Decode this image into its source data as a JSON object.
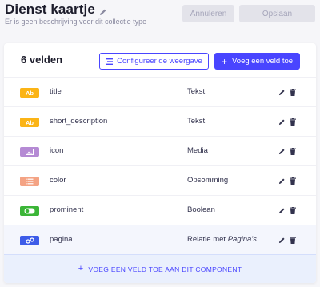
{
  "header": {
    "title": "Dienst kaartje",
    "subtitle": "Er is geen beschrijving voor dit collectie type",
    "cancel_label": "Annuleren",
    "save_label": "Opslaan"
  },
  "card": {
    "count_label": "6 velden",
    "configure_label": "Configureer de weergave",
    "add_field_label": "Voeg een veld toe",
    "add_component_label": "VOEG EEN VELD TOE AAN DIT COMPONENT"
  },
  "fields": [
    {
      "name": "title",
      "type": "Tekst",
      "badge": "Ab",
      "icon": "text-icon",
      "color": "#fbb416"
    },
    {
      "name": "short_description",
      "type": "Tekst",
      "badge": "Ab",
      "icon": "text-icon",
      "color": "#fbb416"
    },
    {
      "name": "icon",
      "type": "Media",
      "badge": "",
      "icon": "media-icon",
      "color": "#b58ad4"
    },
    {
      "name": "color",
      "type": "Opsomming",
      "badge": "",
      "icon": "enumeration-icon",
      "color": "#f4a384"
    },
    {
      "name": "prominent",
      "type": "Boolean",
      "badge": "",
      "icon": "boolean-icon",
      "color": "#3bb537"
    },
    {
      "name": "pagina",
      "type": "Relatie met",
      "type_target": "Pagina's",
      "badge": "",
      "icon": "relation-icon",
      "color": "#3d5ce8"
    }
  ],
  "colors": {
    "accent": "#4945ff",
    "disabled_bg": "#e3e3ea"
  }
}
